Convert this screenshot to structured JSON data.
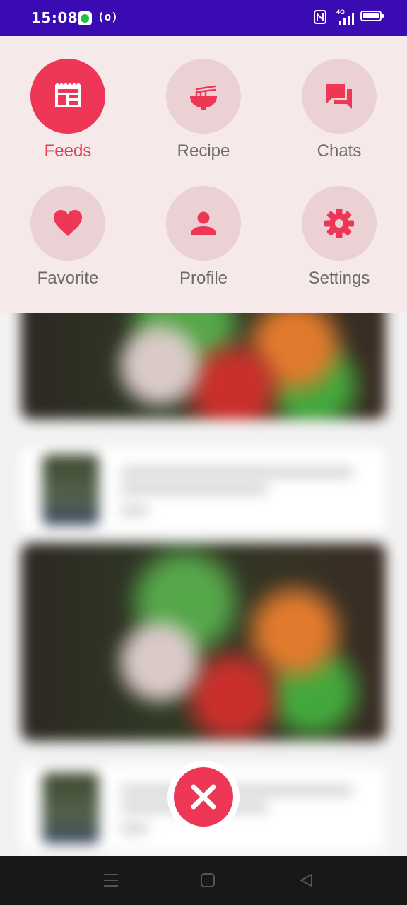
{
  "status_bar": {
    "time": "15:08",
    "icons": [
      "messaging-app-icon",
      "radio-icon",
      "nfc-icon",
      "signal-4g-icon",
      "battery-icon"
    ],
    "network_tag": "4G"
  },
  "menu": {
    "items": [
      {
        "label": "Feeds",
        "icon": "newspaper-icon",
        "active": true
      },
      {
        "label": "Recipe",
        "icon": "noodle-bowl-icon",
        "active": false
      },
      {
        "label": "Chats",
        "icon": "chat-bubbles-icon",
        "active": false
      },
      {
        "label": "Favorite",
        "icon": "heart-icon",
        "active": false
      },
      {
        "label": "Profile",
        "icon": "person-icon",
        "active": false
      },
      {
        "label": "Settings",
        "icon": "gear-icon",
        "active": false
      }
    ]
  },
  "colors": {
    "status_bar": "#3a0bb3",
    "accent": "#ee3656",
    "menu_background": "#f5e9ea",
    "inactive_circle": "#ecd1d4",
    "inactive_label": "#6e6a6a"
  },
  "close_button": {
    "icon": "close-icon"
  },
  "nav_bar": {
    "icons": [
      "menu-icon",
      "home-icon",
      "back-icon"
    ]
  }
}
